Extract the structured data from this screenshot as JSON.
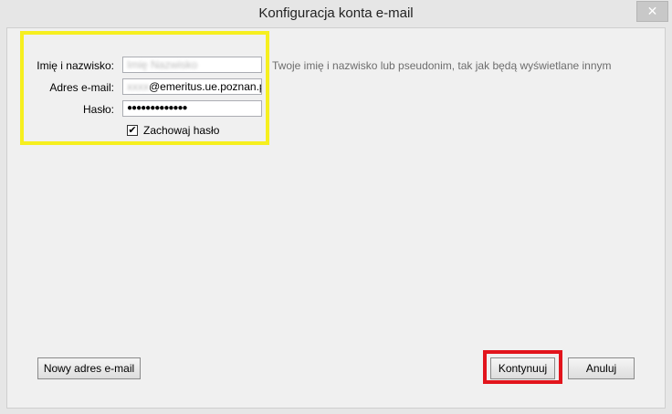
{
  "window": {
    "title": "Konfiguracja konta e-mail",
    "close_label": "✕"
  },
  "form": {
    "name_label": "Imię i nazwisko:",
    "name_value": "Imię Nazwisko",
    "name_hint": "Twoje imię i nazwisko lub pseudonim, tak jak będą wyświetlane innym",
    "email_label": "Adres e-mail:",
    "email_value_hidden": "xxxx",
    "email_value": "@emeritus.ue.poznan.pl",
    "password_label": "Hasło:",
    "password_value": "●●●●●●●●●●●●●",
    "remember_password_label": "Zachowaj hasło",
    "remember_password_checked": true
  },
  "buttons": {
    "new_email": "Nowy adres e-mail",
    "continue": "Kontynuuj",
    "cancel": "Anuluj"
  },
  "colors": {
    "highlight_form": "#f6ef1f",
    "highlight_continue": "#e2141c"
  }
}
